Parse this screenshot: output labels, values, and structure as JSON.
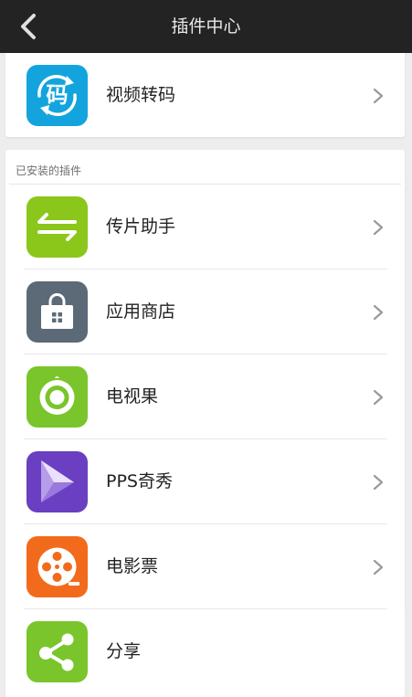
{
  "header": {
    "title": "插件中心"
  },
  "top_item": {
    "label": "视频转码",
    "icon_text": "码",
    "color": "#14a4dd"
  },
  "installed": {
    "section_title": "已安装的插件",
    "items": [
      {
        "label": "传片助手",
        "color": "#8bc61b"
      },
      {
        "label": "应用商店",
        "color": "#5c6a78"
      },
      {
        "label": "电视果",
        "color": "#7ac52b"
      },
      {
        "label": "PPS奇秀",
        "color": "#6a3fc1"
      },
      {
        "label": "电影票",
        "color": "#f26a1b"
      },
      {
        "label": "分享",
        "color": "#7ac52b"
      }
    ]
  }
}
